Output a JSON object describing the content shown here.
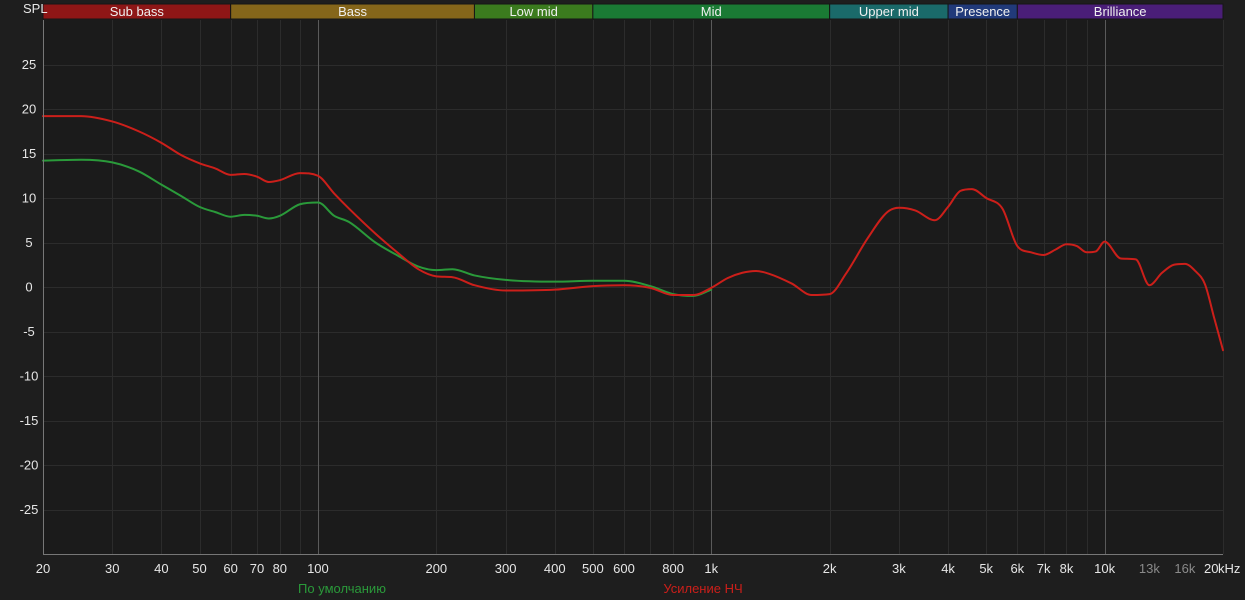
{
  "chart_data": {
    "type": "line",
    "ylabel": "SPL",
    "xunit": "kHz",
    "x_scale": "log",
    "xlim": [
      20,
      20000
    ],
    "ylim": [
      -30,
      30
    ],
    "y_ticks": [
      25,
      20,
      15,
      10,
      5,
      0,
      -5,
      -10,
      -15,
      -20,
      -25
    ],
    "x_ticks": [
      {
        "label": "20",
        "value": 20,
        "faded": false
      },
      {
        "label": "30",
        "value": 30,
        "faded": false
      },
      {
        "label": "40",
        "value": 40,
        "faded": false
      },
      {
        "label": "50",
        "value": 50,
        "faded": false
      },
      {
        "label": "60",
        "value": 60,
        "faded": false
      },
      {
        "label": "70",
        "value": 70,
        "faded": false
      },
      {
        "label": "80",
        "value": 80,
        "faded": false
      },
      {
        "label": "100",
        "value": 100,
        "faded": false
      },
      {
        "label": "200",
        "value": 200,
        "faded": false
      },
      {
        "label": "300",
        "value": 300,
        "faded": false
      },
      {
        "label": "400",
        "value": 400,
        "faded": false
      },
      {
        "label": "500",
        "value": 500,
        "faded": false
      },
      {
        "label": "600",
        "value": 600,
        "faded": false
      },
      {
        "label": "800",
        "value": 800,
        "faded": false
      },
      {
        "label": "1k",
        "value": 1000,
        "faded": false
      },
      {
        "label": "2k",
        "value": 2000,
        "faded": false
      },
      {
        "label": "3k",
        "value": 3000,
        "faded": false
      },
      {
        "label": "4k",
        "value": 4000,
        "faded": false
      },
      {
        "label": "5k",
        "value": 5000,
        "faded": false
      },
      {
        "label": "6k",
        "value": 6000,
        "faded": false
      },
      {
        "label": "7k",
        "value": 7000,
        "faded": false
      },
      {
        "label": "8k",
        "value": 8000,
        "faded": false
      },
      {
        "label": "10k",
        "value": 10000,
        "faded": false
      },
      {
        "label": "13k",
        "value": 13000,
        "faded": true
      },
      {
        "label": "16k",
        "value": 16000,
        "faded": true
      },
      {
        "label": "20",
        "value": 20000,
        "faded": false
      }
    ],
    "major_gridlines_x": [
      100,
      1000,
      10000
    ],
    "grid": true,
    "bands": [
      {
        "name": "Sub bass",
        "from": 20,
        "to": 60,
        "color": "#8e1616"
      },
      {
        "name": "Bass",
        "from": 60,
        "to": 250,
        "color": "#85661a"
      },
      {
        "name": "Low mid",
        "from": 250,
        "to": 500,
        "color": "#3b7b1e"
      },
      {
        "name": "Mid",
        "from": 500,
        "to": 2000,
        "color": "#1a7a34"
      },
      {
        "name": "Upper mid",
        "from": 2000,
        "to": 4000,
        "color": "#1a6a6a"
      },
      {
        "name": "Presence",
        "from": 4000,
        "to": 6000,
        "color": "#213a7a"
      },
      {
        "name": "Brilliance",
        "from": 6000,
        "to": 20000,
        "color": "#4a1e78"
      }
    ],
    "series": [
      {
        "name": "По умолчанию",
        "color": "#2a9a3a",
        "x": [
          20,
          25,
          30,
          35,
          40,
          45,
          50,
          55,
          60,
          65,
          70,
          75,
          80,
          90,
          100,
          110,
          120,
          140,
          160,
          180,
          200,
          220,
          250,
          300,
          400,
          500,
          600,
          700,
          800,
          900,
          1000
        ],
        "values": [
          14.2,
          14.3,
          14.0,
          13.0,
          11.5,
          10.2,
          9.0,
          8.4,
          7.9,
          8.1,
          8.0,
          7.7,
          8.0,
          9.3,
          9.5,
          8.0,
          7.3,
          5.0,
          3.5,
          2.3,
          1.9,
          2.0,
          1.3,
          0.8,
          0.6,
          0.7,
          0.7,
          0.1,
          -0.8,
          -1.0,
          -0.3
        ]
      },
      {
        "name": "Усиление НЧ",
        "color": "#cc1f1a",
        "x": [
          20,
          25,
          30,
          35,
          40,
          45,
          50,
          55,
          60,
          65,
          70,
          75,
          80,
          90,
          100,
          110,
          120,
          140,
          160,
          180,
          200,
          220,
          250,
          300,
          400,
          500,
          600,
          700,
          800,
          900,
          1000,
          1100,
          1200,
          1300,
          1400,
          1600,
          1800,
          2000,
          2200,
          2500,
          2800,
          3000,
          3300,
          3700,
          4000,
          4300,
          4600,
          5000,
          5500,
          6000,
          6500,
          7000,
          7500,
          8000,
          8500,
          9000,
          9500,
          10000,
          11000,
          12000,
          13000,
          14000,
          15000,
          16000,
          17000,
          18000,
          19000,
          20000
        ],
        "values": [
          19.2,
          19.2,
          18.6,
          17.5,
          16.2,
          14.8,
          13.9,
          13.3,
          12.6,
          12.7,
          12.4,
          11.8,
          12.0,
          12.8,
          12.5,
          10.5,
          8.8,
          6.0,
          3.8,
          2.0,
          1.2,
          1.1,
          0.2,
          -0.4,
          -0.3,
          0.1,
          0.2,
          -0.1,
          -0.9,
          -0.9,
          -0.1,
          1.0,
          1.6,
          1.8,
          1.5,
          0.4,
          -0.9,
          -0.8,
          1.5,
          5.5,
          8.4,
          8.9,
          8.6,
          7.5,
          9.0,
          10.8,
          11.0,
          10.0,
          8.8,
          4.6,
          3.9,
          3.6,
          4.2,
          4.8,
          4.6,
          3.9,
          4.0,
          5.1,
          3.2,
          3.1,
          0.2,
          1.6,
          2.5,
          2.6,
          1.8,
          0.3,
          -3.5,
          -7.1
        ]
      }
    ]
  }
}
